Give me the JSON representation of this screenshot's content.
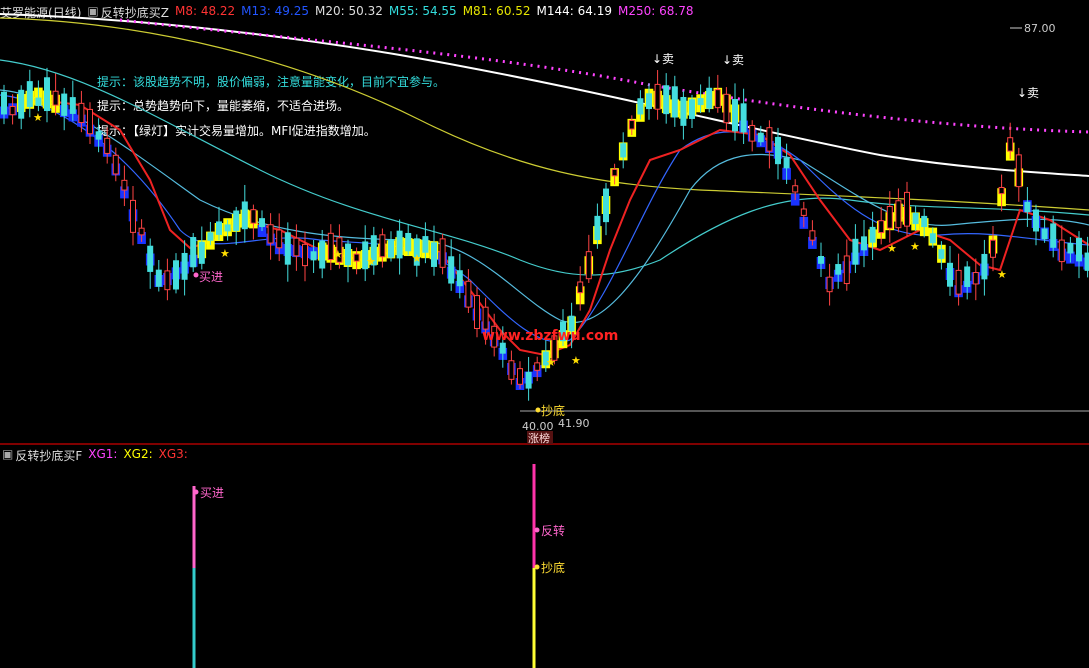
{
  "main_header": {
    "stock_name": "艾罗能源",
    "period": "(日线)",
    "indicator": "反转抄底买Z",
    "mas": [
      {
        "label": "M8:",
        "value": "48.22",
        "color": "#ff3333"
      },
      {
        "label": "M13:",
        "value": "49.25",
        "color": "#2255ff"
      },
      {
        "label": "M20:",
        "value": "50.32",
        "color": "#dddddd"
      },
      {
        "label": "M55:",
        "value": "54.55",
        "color": "#33dddd"
      },
      {
        "label": "M81:",
        "value": "60.52",
        "color": "#e6e600"
      },
      {
        "label": "M144:",
        "value": "64.19",
        "color": "#ffffff"
      },
      {
        "label": "M250:",
        "value": "68.78",
        "color": "#ff44ff"
      }
    ]
  },
  "hints": [
    {
      "prefix": "提示：",
      "text": "该股趋势不明，股价偏弱，注意量能变化，目前不宜参与。",
      "color": "#33dddd"
    },
    {
      "prefix": "提示：",
      "text": "总势趋势向下，量能萎缩，不适合进场。",
      "color": "#ffffff"
    },
    {
      "prefix": "提示：",
      "text": "【绿灯】实计交易量增加。MFI促进指数增加。",
      "color": "#ffffff"
    }
  ],
  "chart_labels": {
    "sell": "↓卖",
    "buy": "买进",
    "bottom": "抄底",
    "limit_up": "涨榜",
    "high_price": "87.00",
    "low_price": "40.00",
    "low_range": "41.90",
    "watermark": "www.zbzfwu.com"
  },
  "sub_header": {
    "indicator": "反转抄底买F",
    "items": [
      {
        "label": "XG1:",
        "color": "#ff44ff"
      },
      {
        "label": "XG2:",
        "color": "#ffff00"
      },
      {
        "label": "XG3:",
        "color": "#ff3333"
      }
    ]
  },
  "sub_labels": {
    "buy": "买进",
    "reversal": "反转",
    "bottom": "抄底"
  }
}
